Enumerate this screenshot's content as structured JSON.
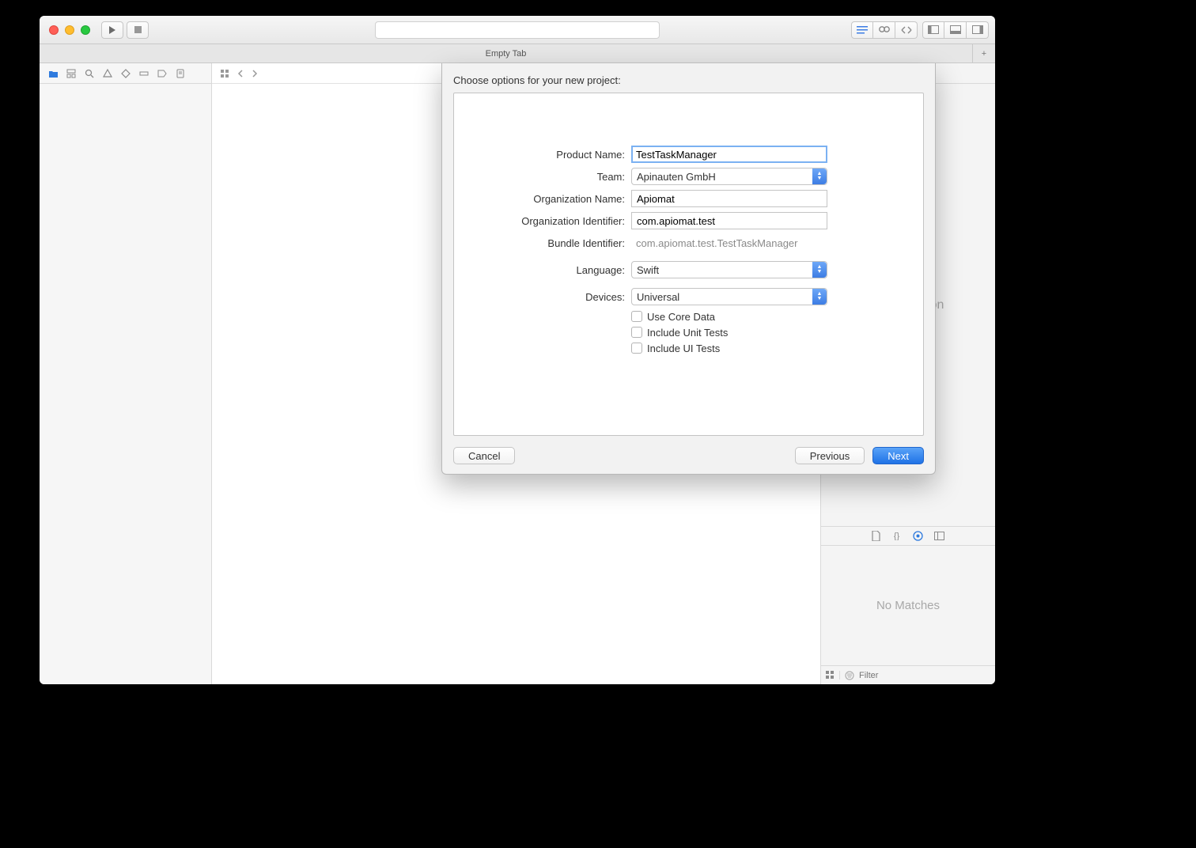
{
  "tabbar": {
    "empty_tab": "Empty Tab"
  },
  "inspector": {
    "no_selection": "No Selection"
  },
  "library": {
    "no_matches": "No Matches",
    "filter_placeholder": "Filter"
  },
  "sheet": {
    "title": "Choose options for your new project:",
    "labels": {
      "product_name": "Product Name:",
      "team": "Team:",
      "org_name": "Organization Name:",
      "org_id": "Organization Identifier:",
      "bundle_id": "Bundle Identifier:",
      "language": "Language:",
      "devices": "Devices:"
    },
    "values": {
      "product_name": "TestTaskManager",
      "team": "Apinauten GmbH",
      "org_name": "Apiomat",
      "org_id": "com.apiomat.test",
      "bundle_id": "com.apiomat.test.TestTaskManager",
      "language": "Swift",
      "devices": "Universal"
    },
    "checks": {
      "core_data": "Use Core Data",
      "unit_tests": "Include Unit Tests",
      "ui_tests": "Include UI Tests"
    },
    "buttons": {
      "cancel": "Cancel",
      "previous": "Previous",
      "next": "Next"
    }
  }
}
